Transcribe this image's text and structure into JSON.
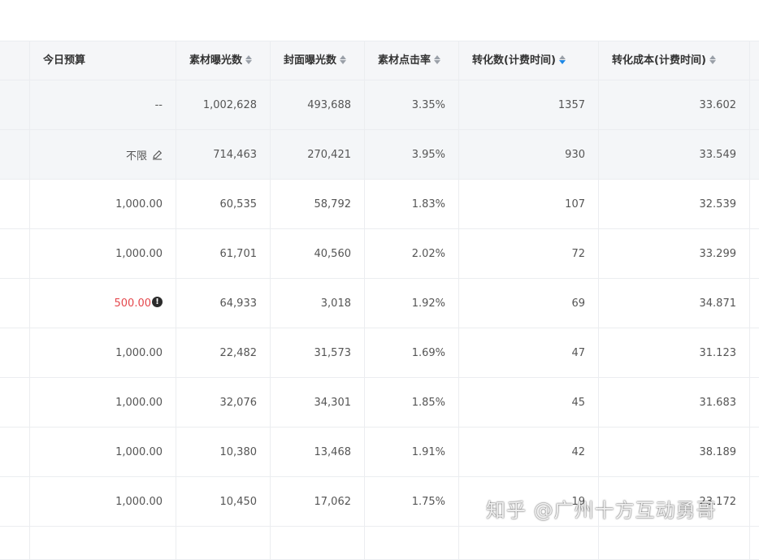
{
  "columns": {
    "budget": "今日预算",
    "material_impressions": "素材曝光数",
    "cover_impressions": "封面曝光数",
    "ctr": "素材点击率",
    "conversions": "转化数(计费时间)",
    "cost_per_conversion": "转化成本(计费时间)"
  },
  "sort_icons": {
    "material_impressions": "sort-both-icon",
    "cover_impressions": "sort-both-icon",
    "ctr": "sort-both-icon",
    "conversions": "sort-descending-active-icon",
    "cost_per_conversion": "sort-both-icon"
  },
  "colors": {
    "sort_active": "#1e88e5",
    "warning_value": "#e5484d",
    "summary_bg": "#f4f6f8"
  },
  "rows": [
    {
      "budget": "--",
      "material_impressions": "1,002,628",
      "cover_impressions": "493,688",
      "ctr": "3.35%",
      "conversions": "1357",
      "cost": "33.602"
    },
    {
      "budget": "不限",
      "material_impressions": "714,463",
      "cover_impressions": "270,421",
      "ctr": "3.95%",
      "conversions": "930",
      "cost": "33.549"
    },
    {
      "budget": "1,000.00",
      "material_impressions": "60,535",
      "cover_impressions": "58,792",
      "ctr": "1.83%",
      "conversions": "107",
      "cost": "32.539"
    },
    {
      "budget": "1,000.00",
      "material_impressions": "61,701",
      "cover_impressions": "40,560",
      "ctr": "2.02%",
      "conversions": "72",
      "cost": "33.299"
    },
    {
      "budget": "500.00",
      "material_impressions": "64,933",
      "cover_impressions": "3,018",
      "ctr": "1.92%",
      "conversions": "69",
      "cost": "34.871"
    },
    {
      "budget": "1,000.00",
      "material_impressions": "22,482",
      "cover_impressions": "31,573",
      "ctr": "1.69%",
      "conversions": "47",
      "cost": "31.123"
    },
    {
      "budget": "1,000.00",
      "material_impressions": "32,076",
      "cover_impressions": "34,301",
      "ctr": "1.85%",
      "conversions": "45",
      "cost": "31.683"
    },
    {
      "budget": "1,000.00",
      "material_impressions": "10,380",
      "cover_impressions": "13,468",
      "ctr": "1.91%",
      "conversions": "42",
      "cost": "38.189"
    },
    {
      "budget": "1,000.00",
      "material_impressions": "10,450",
      "cover_impressions": "17,062",
      "ctr": "1.75%",
      "conversions": "19",
      "cost": "23.172"
    }
  ],
  "warning_glyph": "!",
  "watermark": "知乎 @广州十方互动勇哥"
}
